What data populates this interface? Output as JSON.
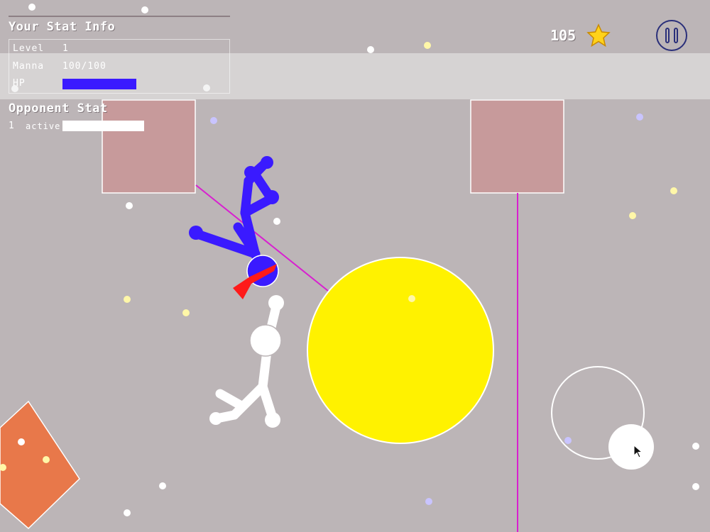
{
  "your_stats": {
    "title": "Your Stat Info",
    "level_label": "Level",
    "level_value": "1",
    "manna_label": "Manna",
    "manna_value": "100/100",
    "hp_label": "HP",
    "hp_fraction": 1.0
  },
  "opponent_stats": {
    "title": "Opponent Stat",
    "count": "1",
    "status": "active",
    "hp_fraction": 1.0
  },
  "coins": {
    "value": "105",
    "icon": "star-icon"
  },
  "pause": {
    "icon": "pause-icon"
  },
  "colors": {
    "background": "#bcb5b7",
    "player": "#3a1aff",
    "opponent": "#ffffff",
    "sun": "#fff200",
    "rope": "#d81fd0",
    "block": "#c79a9b",
    "orange_block": "#e8784a",
    "bandana": "#ff1a1a"
  }
}
